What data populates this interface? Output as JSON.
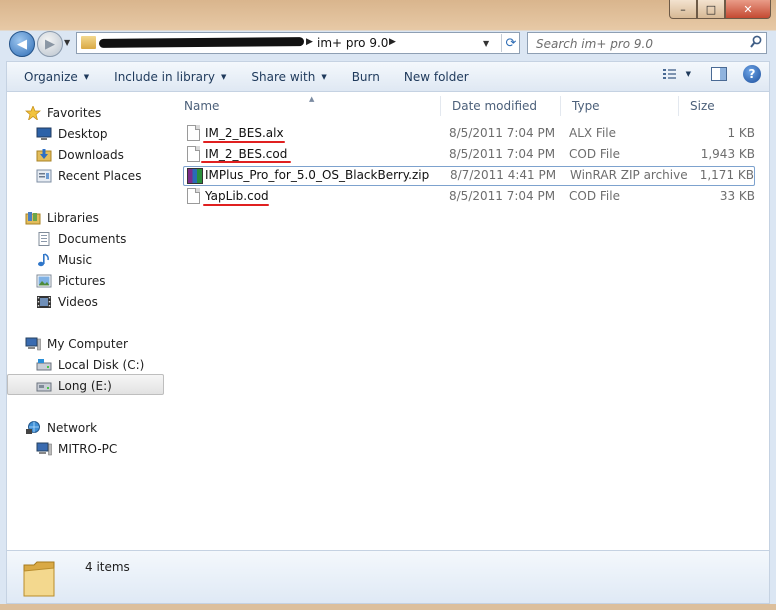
{
  "window": {
    "buttons": {
      "minimize": "–",
      "maximize": "□",
      "close": "✕"
    }
  },
  "address": {
    "crumb": "im+ pro 9.0",
    "search_placeholder": "Search im+ pro 9.0"
  },
  "toolbar": {
    "organize": "Organize",
    "include_in_library": "Include in library",
    "share_with": "Share with",
    "burn": "Burn",
    "new_folder": "New folder"
  },
  "sidebar": {
    "favorites": {
      "label": "Favorites",
      "items": [
        "Desktop",
        "Downloads",
        "Recent Places"
      ]
    },
    "libraries": {
      "label": "Libraries",
      "items": [
        "Documents",
        "Music",
        "Pictures",
        "Videos"
      ]
    },
    "computer": {
      "label": "My Computer",
      "items": [
        "Local Disk (C:)",
        "Long (E:)"
      ]
    },
    "network": {
      "label": "Network",
      "items": [
        "MITRO-PC"
      ]
    }
  },
  "columns": {
    "name": "Name",
    "date": "Date modified",
    "type": "Type",
    "size": "Size"
  },
  "files": [
    {
      "name": "IM_2_BES.alx",
      "date": "8/5/2011 7:04 PM",
      "type": "ALX File",
      "size": "1 KB"
    },
    {
      "name": "IM_2_BES.cod",
      "date": "8/5/2011 7:04 PM",
      "type": "COD File",
      "size": "1,943 KB"
    },
    {
      "name": "IMPlus_Pro_for_5.0_OS_BlackBerry.zip",
      "date": "8/7/2011 4:41 PM",
      "type": "WinRAR ZIP archive",
      "size": "1,171 KB"
    },
    {
      "name": "YapLib.cod",
      "date": "8/5/2011 7:04 PM",
      "type": "COD File",
      "size": "33 KB"
    }
  ],
  "details": {
    "count": "4 items"
  },
  "colors": {
    "annotation": "#e02020",
    "selection_border": "#7da2ce",
    "toolbar_text": "#1e395b"
  }
}
